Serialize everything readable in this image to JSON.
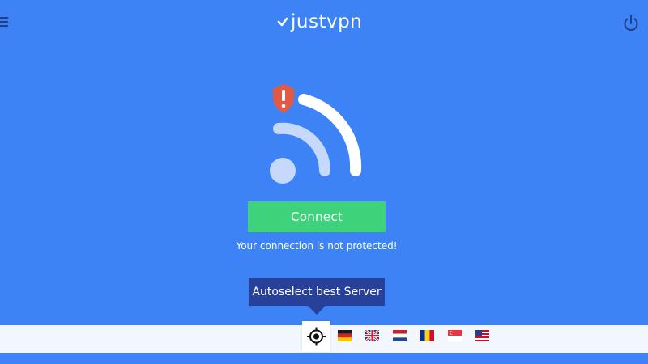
{
  "header": {
    "brand": "justvpn",
    "menu_icon": "hamburger-menu-icon",
    "power_icon": "power-icon"
  },
  "main": {
    "connect_label": "Connect",
    "status_text": "Your connection is not protected!",
    "status_icon": "warning-shield-icon"
  },
  "server_bar": {
    "tooltip": "Autoselect best Server",
    "autoselect_icon": "crosshair-icon",
    "flags": [
      "de-flag-icon",
      "gb-flag-icon",
      "nl-flag-icon",
      "ro-flag-icon",
      "sg-flag-icon",
      "us-flag-icon"
    ]
  },
  "colors": {
    "background": "#3d83f5",
    "connect_button": "#3ed27a",
    "tooltip": "#27419b",
    "warning": "#e35a44"
  }
}
